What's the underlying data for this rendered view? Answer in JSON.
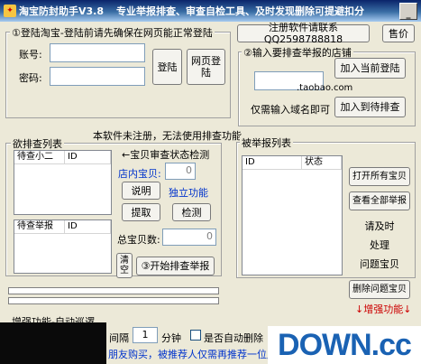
{
  "window": {
    "title": "淘宝防封助手V3.8",
    "tagline": "专业举报排查、审查自检工具、及时发现删除可提避扣分",
    "min_glyph": "_"
  },
  "login_panel": {
    "legend": "①登陆淘宝-登陆前请先确保在网页能正常登陆",
    "account_label": "账号:",
    "password_label": "密码:",
    "account_value": "",
    "password_value": "",
    "login_button": "登陆",
    "web_login_button": "网页登陆"
  },
  "header_buttons": {
    "register": "注册软件请联系QQ2598788818",
    "sell": "售价"
  },
  "shop_panel": {
    "legend": "②输入要排查举报的店铺",
    "shop_input": "",
    "add_current_login": "加入当前登陆",
    "domain_suffix": ".taobao.com",
    "hint": "仅需输入域名即可",
    "add_to_check": "加入到待排查"
  },
  "check_list": {
    "legend": "欲排查列表",
    "unregistered_notice": "本软件未注册，无法使用排查功能",
    "top_headers": [
      "待查小二",
      "ID"
    ],
    "bottom_headers": [
      "待查举报",
      "ID"
    ]
  },
  "audit_panel": {
    "title": "←宝贝审查状态检测",
    "in_store_label": "店内宝贝:",
    "in_store_value": "0",
    "explain_button": "说明",
    "independent_label": "独立功能",
    "extract_button": "提取",
    "detect_button": "检测",
    "total_label": "总宝贝数:",
    "total_value": "0",
    "clear_button": "清空",
    "start_button": "③开始排查举报"
  },
  "reported_list": {
    "legend": "被举报列表",
    "headers": [
      "ID",
      "状态"
    ],
    "open_all_button": "打开所有宝贝",
    "view_all_button": "查看全部举报",
    "notice_lines": [
      "请及时",
      "处理",
      "问题宝贝"
    ],
    "delete_button": "删除问题宝贝",
    "enhance_label": "↓增强功能↓"
  },
  "progress": {
    "bar1_fill": 0,
    "bar2_fill": 0
  },
  "patrol": {
    "legend": "增强功能-自动巡逻",
    "interval_prefix": "间隔",
    "interval_value": "1",
    "interval_unit": "分钟",
    "auto_delete_label": "是否自动删除",
    "recommend_text": "朋友购买，被推荐人仅需再推荐一位朋"
  },
  "watermark": {
    "text": "DOWN.cc"
  },
  "colors": {
    "window_bg": "#ece9d8",
    "title_start": "#0a246a",
    "blue_label": "#0033cc",
    "red_label": "#cc0000",
    "watermark_blue": "#1a62b3"
  }
}
